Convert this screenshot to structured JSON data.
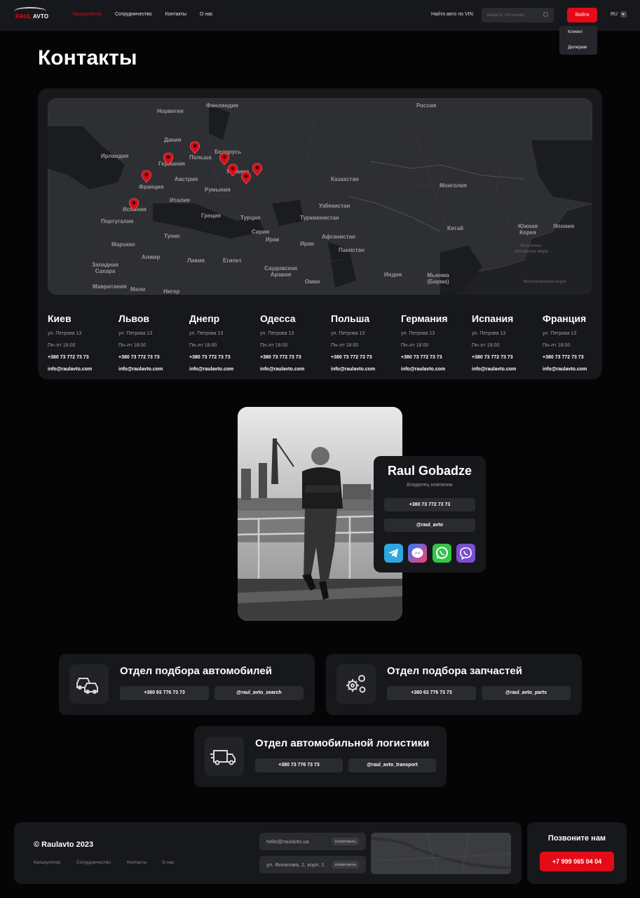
{
  "header": {
    "logo_text_red": "RAUL",
    "logo_text_white": "AVTO",
    "nav": [
      "Калькулятор",
      "Сотрудничество",
      "Контакты",
      "О нас"
    ],
    "vin_label": "Найти авто по VIN:",
    "vin_placeholder": "Введите VIN-номер",
    "login": "Войти",
    "lang": "RU",
    "dropdown": [
      "Клиент",
      "Дилерам"
    ]
  },
  "page_title": "Контакты",
  "map": {
    "countries": [
      "Норвегия",
      "Финляндия",
      "Россия",
      "Дания",
      "Ирландия",
      "Беларусь",
      "Германия",
      "Польша",
      "Украина",
      "Казахстан",
      "Франция",
      "Австрия",
      "Румыния",
      "Монголия",
      "Италия",
      "Испания",
      "Узбекистан",
      "Португалия",
      "Греция",
      "Турция",
      "Туркменистан",
      "Китай",
      "Южная Корея",
      "Япония",
      "Тунис",
      "Сирия",
      "Афганистан",
      "Марокко",
      "Ирак",
      "Иран",
      "Пакистан",
      "Алжир",
      "Ливия",
      "Египет",
      "Западная Сахара",
      "Саудовская Аравия",
      "Индия",
      "Мьянма (Бирма)",
      "Мавритания",
      "Мали",
      "Нигер",
      "Оман"
    ],
    "water": [
      "Восточно-Китайское море",
      "Филиппинское море"
    ]
  },
  "offices": [
    {
      "city": "Киев",
      "address": "ул. Петрова 13",
      "hours": "Пн–пт 18:00",
      "phone": "+380 73 772 73 73",
      "email": "info@raulavto.com"
    },
    {
      "city": "Львов",
      "address": "ул. Петрова 13",
      "hours": "Пн–пт 18:00",
      "phone": "+380 73 772 73 73",
      "email": "info@raulavto.com"
    },
    {
      "city": "Днепр",
      "address": "ул. Петрова 13",
      "hours": "Пн–пт 18:00",
      "phone": "+380 73 772 73 73",
      "email": "info@raulavto.com"
    },
    {
      "city": "Одесса",
      "address": "ул. Петрова 13",
      "hours": "Пн–пт 18:00",
      "phone": "+380 73 772 73 73",
      "email": "info@raulavto.com"
    },
    {
      "city": "Польша",
      "address": "ул. Петрова 13",
      "hours": "Пн–пт 18:00",
      "phone": "+380 73 772 73 73",
      "email": "info@raulavto.com"
    },
    {
      "city": "Германия",
      "address": "ул. Петрова 13",
      "hours": "Пн–пт 18:00",
      "phone": "+380 73 772 73 73",
      "email": "info@raulavto.com"
    },
    {
      "city": "Испания",
      "address": "ул. Петрова 13",
      "hours": "Пн–пт 18:00",
      "phone": "+380 73 772 73 73",
      "email": "info@raulavto.com"
    },
    {
      "city": "Франция",
      "address": "ул. Петрова 13",
      "hours": "Пн–пт 18:00",
      "phone": "+380 73 772 73 73",
      "email": "info@raulavto.com"
    }
  ],
  "owner": {
    "name": "Raul Gobadze",
    "role": "Владелец компании",
    "phone": "+380 73 772 73 73",
    "handle": "@raul_avto",
    "socials": [
      "telegram-icon",
      "messenger-icon",
      "whatsapp-icon",
      "viber-icon"
    ]
  },
  "departments": [
    {
      "title": "Отдел подбора автомобилей",
      "phone": "+380 93 776 73 73",
      "handle": "@raul_avto_search",
      "icon": "cars-icon"
    },
    {
      "title": "Отдел подбора запчастей",
      "phone": "+380 63 776 73 73",
      "handle": "@raul_avto_parts",
      "icon": "gears-icon"
    },
    {
      "title": "Отдел автомобильной логистики",
      "phone": "+380 73 776 73 73",
      "handle": "@raul_avto_transport",
      "icon": "truck-icon"
    }
  ],
  "footer": {
    "copyright": "© Raulavto 2023",
    "nav": [
      "Калькулятор",
      "Сотрудничество",
      "Контакты",
      "О нас"
    ],
    "email": "hello@raulavto.ua",
    "address": "ул. Филатова, 2, корп. 1",
    "copy_label": "КОПИРОВАТЬ",
    "call_title": "Позвоните нам",
    "call_phone": "+7 999 065 04 04"
  },
  "colors": {
    "accent": "#e30b17",
    "background": "#050506",
    "card": "#17181b",
    "pill": "#2a2b30"
  }
}
